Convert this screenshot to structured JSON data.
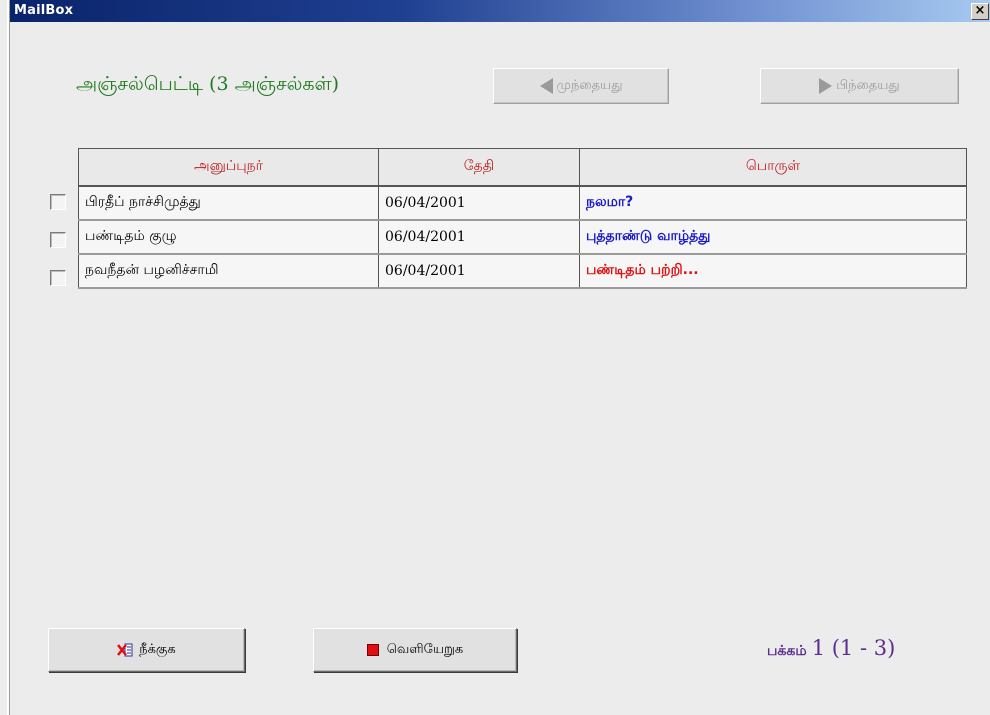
{
  "window": {
    "title": "MailBox",
    "close_label": "×"
  },
  "heading": "அஞ்சல்பெட்டி (3 அஞ்சல்கள்)",
  "nav": {
    "prev_label": "முந்தையது",
    "next_label": "பிந்தையது"
  },
  "table": {
    "headers": [
      "அனுப்புநர்",
      "தேதி",
      "பொருள்"
    ],
    "rows": [
      {
        "sender": "பிரதீப் நாச்சிமுத்து",
        "date": "06/04/2001",
        "subject": "நலமா?",
        "subject_color": "#1a1acc"
      },
      {
        "sender": "பண்டிதம் குழு",
        "date": "06/04/2001",
        "subject": "புத்தாண்டு   வாழ்த்து",
        "subject_color": "#1a1acc"
      },
      {
        "sender": "நவநீதன் பழனிச்சாமி",
        "date": "06/04/2001",
        "subject": "பண்டிதம்   பற்றி...",
        "subject_color": "#e01010"
      }
    ]
  },
  "buttons": {
    "delete_label": "நீக்குக",
    "exit_label": "வெளியேறுக"
  },
  "pagination": {
    "label": "பக்கம்",
    "value": "1 (1 - 3)"
  },
  "colors": {
    "heading": "#1f7a1f",
    "header_text": "#c0181c",
    "pagination": "#5a2d90"
  }
}
